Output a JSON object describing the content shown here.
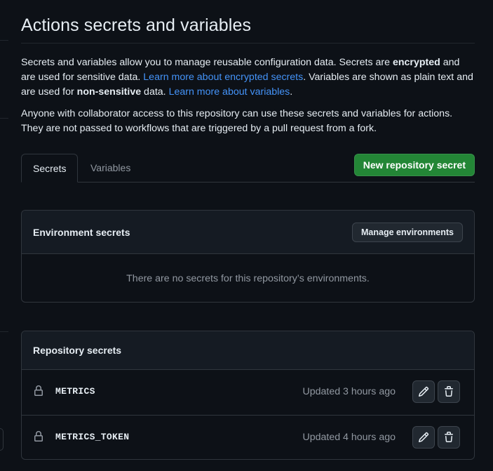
{
  "page": {
    "title": "Actions secrets and variables"
  },
  "intro": {
    "p1_part1": "Secrets and variables allow you to manage reusable configuration data. Secrets are ",
    "p1_bold1": "encrypted",
    "p1_part2": " and are used for sensitive data. ",
    "p1_link1": "Learn more about encrypted secrets",
    "p1_part3": ". Variables are shown as plain text and are used for ",
    "p1_bold2": "non-sensitive",
    "p1_part4": " data. ",
    "p1_link2": "Learn more about variables",
    "p1_part5": ".",
    "p2": "Anyone with collaborator access to this repository can use these secrets and variables for actions. They are not passed to workflows that are triggered by a pull request from a fork."
  },
  "tabs": [
    {
      "label": "Secrets",
      "active": true
    },
    {
      "label": "Variables",
      "active": false
    }
  ],
  "new_secret_button": "New repository secret",
  "environment_secrets": {
    "title": "Environment secrets",
    "manage_button": "Manage environments",
    "empty_message": "There are no secrets for this repository’s environments."
  },
  "repository_secrets": {
    "title": "Repository secrets",
    "items": [
      {
        "name": "METRICS",
        "updated": "Updated 3 hours ago",
        "icon": "lock-icon"
      },
      {
        "name": "METRICS_TOKEN",
        "updated": "Updated 4 hours ago",
        "icon": "lock-icon"
      }
    ]
  },
  "colors": {
    "background": "#0d1117",
    "primary_button": "#238636",
    "link": "#4493f8",
    "muted_text": "#9198a1",
    "border": "#30363d"
  }
}
